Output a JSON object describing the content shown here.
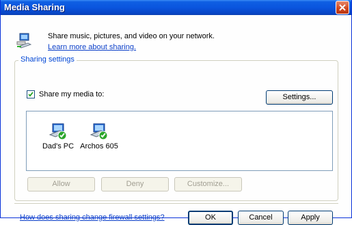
{
  "window": {
    "title": "Media Sharing"
  },
  "intro": {
    "description": "Share music, pictures, and video on your network.",
    "learn_more_link": "Learn more about sharing."
  },
  "sharing_settings": {
    "group_label": "Sharing settings",
    "share_checkbox": {
      "label": "Share my media to:",
      "checked": true
    },
    "settings_button": "Settings...",
    "devices": [
      {
        "name": "Dad's PC",
        "icon": "network-computer-check-icon"
      },
      {
        "name": "Archos 605",
        "icon": "network-computer-check-icon"
      }
    ],
    "buttons": {
      "allow": "Allow",
      "deny": "Deny",
      "customize": "Customize..."
    }
  },
  "footer": {
    "firewall_link": "How does sharing change firewall settings?",
    "ok": "OK",
    "cancel": "Cancel",
    "apply": "Apply"
  }
}
